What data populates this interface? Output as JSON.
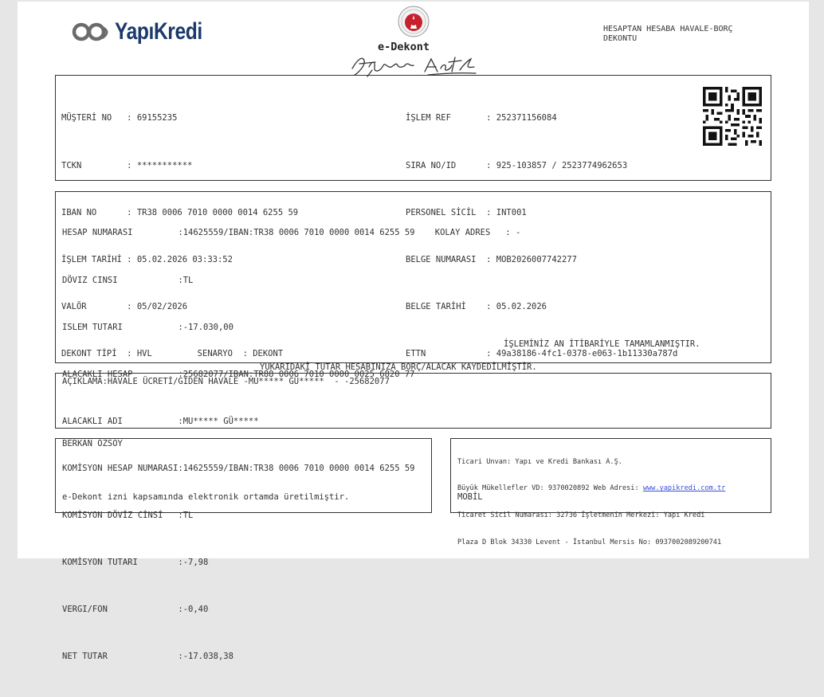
{
  "header": {
    "bank_logo_text": "YapıKredi",
    "title": "e-Dekont",
    "doc_type": "HESAPTAN HESABA HAVALE-BORÇ\nDEKONTU"
  },
  "customer_block": {
    "left_rows": [
      "MÜŞTERİ NO   : 69155235",
      "TCKN         : ***********",
      "IBAN NO      : TR38 0006 7010 0000 0014 6255 59",
      "İŞLEM TARİHİ : 05.02.2026 03:33:52",
      "VALÖR        : 05/02/2026",
      "DEKONT TİPİ  : HVL         SENARYO  : DEKONT"
    ],
    "right_rows": [
      "İŞLEM REF       : 252371156084",
      "SIRA NO/ID      : 925-103857 / 2523774962653",
      "PERSONEL SİCİL  : INT001",
      "BELGE NUMARASI  : MOB2026007742277",
      "BELGE TARİHİ    : 05.02.2026",
      "ETTN            : 49a38186-4fc1-0378-e063-1b11330a787d"
    ]
  },
  "transaction_block": {
    "rows": [
      "HESAP NUMARASI         :14625559/IBAN:TR38 0006 7010 0000 0014 6255 59    KOLAY ADRES   : -",
      "DÖVIZ CINSI            :TL",
      "ISLEM TUTARI           :-17.030,00",
      "ALACAKLI HESAP         :25682077/IBAN:TR88 0006 7010 0000 0025 6820 77",
      "ALACAKLI ADI           :MU***** GÜ*****",
      "KOMİSYON HESAP NUMARASI:14625559/IBAN:TR38 0006 7010 0000 0014 6255 59",
      "KOMİSYON DÖVİZ CİNSİ   :TL",
      "KOMİSYON TUTARI        :-7,98",
      "VERGI/FON              :-0,40",
      "NET TUTAR              :-17.038,38"
    ],
    "completed_text": "İŞLEMİNİZ AN İTİBARİYLE TAMAMLANMIŞTIR."
  },
  "notice": "YUKARIDAKİ TUTAR HESABINIZA BORÇ/ALACAK KAYDEDİLMİŞTİR.",
  "description": "AÇIKLAMA:HAVALE ÜCRETİ/GIDEN HAVALE -MU***** GÜ*****  - -25682077",
  "footer_left": {
    "name": "BERKAN ÖZSOY",
    "note": "e-Dekont izni kapsamında elektronik ortamda üretilmiştir."
  },
  "footer_right": {
    "line1": "Ticari Unvan: Yapı ve Kredi Bankası A.Ş.",
    "line2_prefix": "Büyük Mükellefler VD: 9370020892 Web Adresi: ",
    "line2_link": "www.yapikredi.com.tr",
    "line3": "Ticaret Sicil Numarası: 32736 İşletmenin Merkezi: Yapı Kredi",
    "line4": "Plaza D Blok 34330 Levent - İstanbul Mersis No: 0937002089200741",
    "channel": "MOBİL"
  },
  "colors": {
    "brand_navy": "#1b3a6b",
    "seal_red": "#c8202c",
    "link_blue": "#3b4fd6"
  }
}
